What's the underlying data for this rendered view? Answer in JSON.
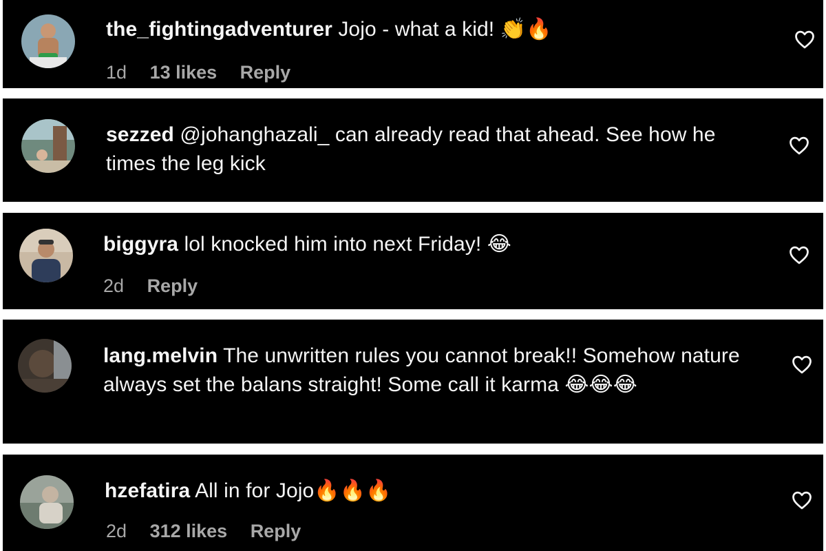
{
  "comments": [
    {
      "username": "the_fightingadventurer",
      "text": "Jojo - what a kid! 👏🔥",
      "time": "1d",
      "likes": "13 likes",
      "reply": "Reply"
    },
    {
      "username": "sezzed",
      "text": "@johanghazali_ can already read that ahead. See how he times the leg kick",
      "time": "",
      "likes": "",
      "reply": ""
    },
    {
      "username": "biggyra",
      "text": "lol knocked him into next Friday! 😂",
      "time": "2d",
      "likes": "",
      "reply": "Reply"
    },
    {
      "username": "lang.melvin",
      "text": "The unwritten rules you cannot break!! Somehow nature always set the balans straight! Some call it karma 😂😂😂",
      "time": "",
      "likes": "",
      "reply": ""
    },
    {
      "username": "hzefatira",
      "text": "All in for Jojo🔥🔥🔥",
      "time": "2d",
      "likes": "312 likes",
      "reply": "Reply"
    }
  ],
  "icons": {
    "like": "heart-icon",
    "avatar": "user-avatar"
  },
  "colors": {
    "background": "#000000",
    "text": "#f5f5f5",
    "meta": "#a8a8a8",
    "divider": "#ffffff"
  }
}
